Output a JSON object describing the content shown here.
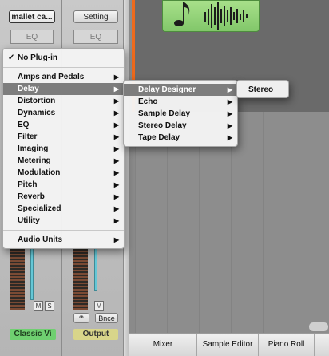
{
  "strips": {
    "left": {
      "plugin_slot": "mallet ca...",
      "eq": "EQ",
      "name": "Classic Vi",
      "name_color": "#6fcf70",
      "mute": "M",
      "solo": "S"
    },
    "right": {
      "plugin_slot": "Setting",
      "eq": "EQ",
      "name": "Output",
      "name_color": "#d8d58a",
      "mute": "M",
      "link_icon": "link-icon",
      "bounce": "Bnce"
    }
  },
  "menu": {
    "no_plugin": "No Plug-in",
    "items": [
      "Amps and Pedals",
      "Delay",
      "Distortion",
      "Dynamics",
      "EQ",
      "Filter",
      "Imaging",
      "Metering",
      "Modulation",
      "Pitch",
      "Reverb",
      "Specialized",
      "Utility"
    ],
    "audio_units": "Audio Units",
    "highlighted": "Delay"
  },
  "delay_menu": {
    "items": [
      "Delay Designer",
      "Echo",
      "Sample Delay",
      "Stereo Delay",
      "Tape Delay"
    ],
    "highlighted": "Delay Designer"
  },
  "designer_menu": {
    "items": [
      "Stereo"
    ]
  },
  "bottom_tabs": [
    "Mixer",
    "Sample Editor",
    "Piano Roll"
  ],
  "colors": {
    "accent_orange": "#ee6a1c",
    "region_green": "#94d57a",
    "menu_highlight": "#7d7d7d"
  }
}
